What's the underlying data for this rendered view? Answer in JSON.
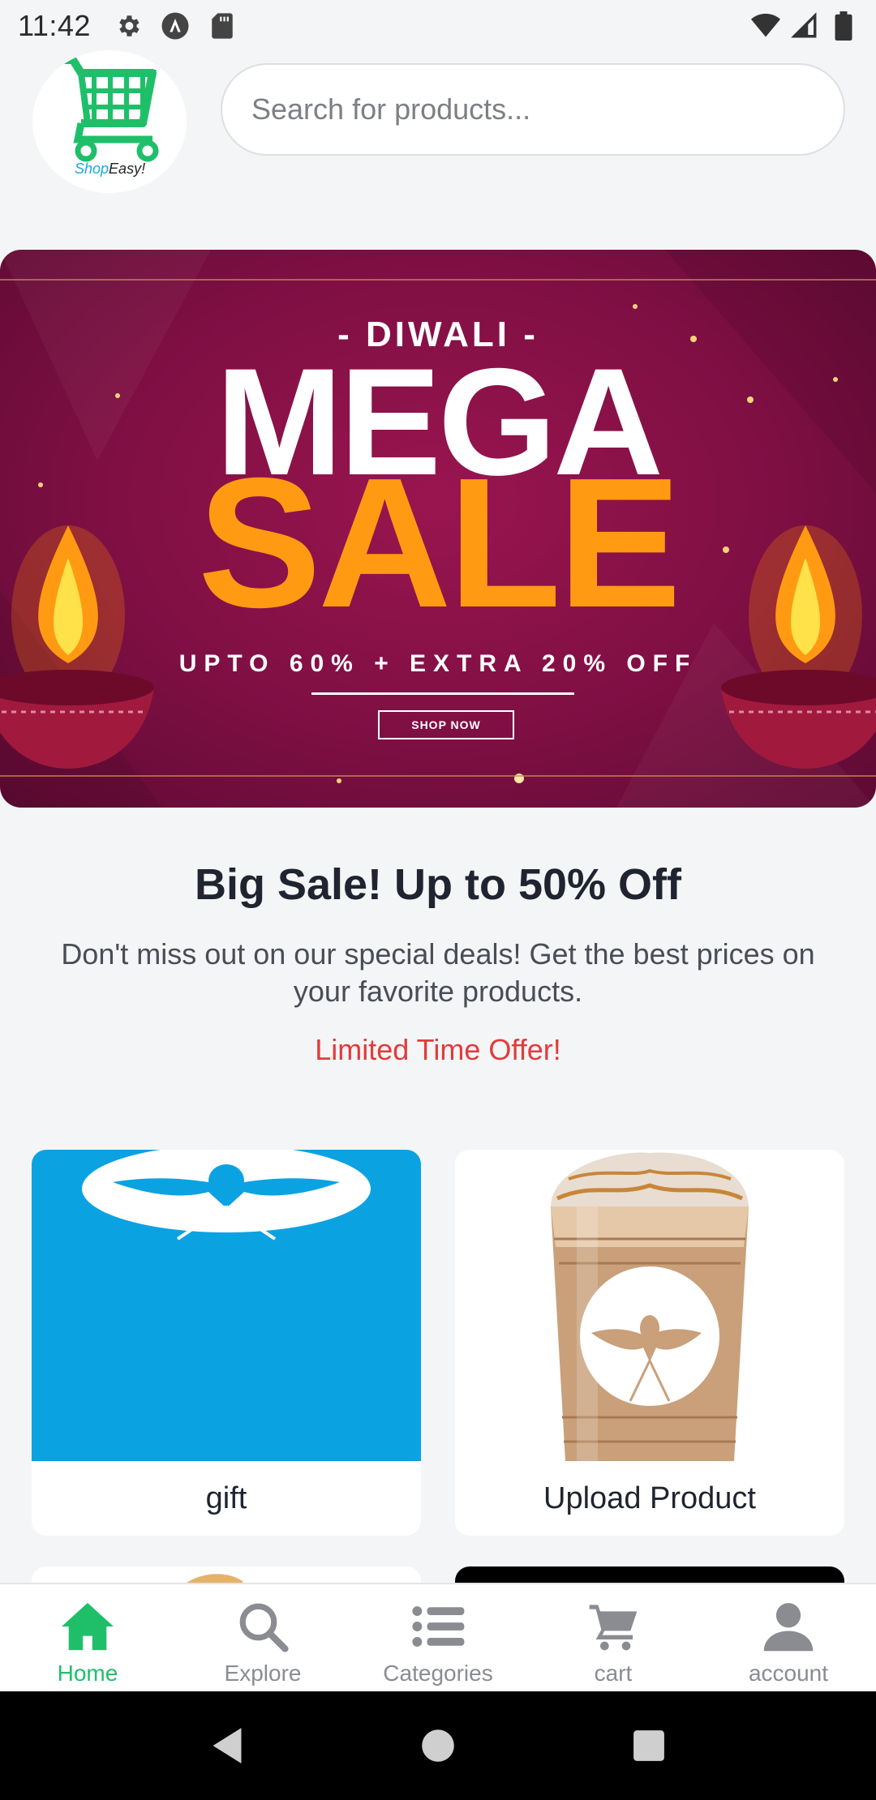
{
  "status_bar": {
    "time": "11:42",
    "left_icons": [
      "gear-icon",
      "a-circle-icon",
      "sd-card-icon"
    ],
    "right_icons": [
      "wifi-icon",
      "signal-icon",
      "battery-icon"
    ]
  },
  "header": {
    "logo": {
      "brand_part1": "Shop",
      "brand_part2": "Easy!"
    },
    "search": {
      "placeholder": "Search for products...",
      "value": ""
    }
  },
  "banner": {
    "kicker": "- DIWALI -",
    "headline_1": "MEGA",
    "headline_2": "SALE",
    "offer": "UPTO 60% + EXTRA 20% OFF",
    "cta": "SHOP NOW"
  },
  "promo": {
    "title": "Big Sale! Up to 50% Off",
    "description": "Don't miss out on our special deals! Get the best prices on your favorite products.",
    "limited": "Limited Time Offer!"
  },
  "products": [
    {
      "label": "gift"
    },
    {
      "label": "Upload Product"
    }
  ],
  "bottom_nav": {
    "items": [
      {
        "label": "Home",
        "icon": "home-icon",
        "active": true
      },
      {
        "label": "Explore",
        "icon": "search-icon",
        "active": false
      },
      {
        "label": "Categories",
        "icon": "list-icon",
        "active": false
      },
      {
        "label": "cart",
        "icon": "cart-icon",
        "active": false
      },
      {
        "label": "account",
        "icon": "person-icon",
        "active": false
      }
    ]
  },
  "colors": {
    "accent_green": "#1fbf6a",
    "offer_red": "#e23b3b",
    "banner_maroon": "#7e0f43",
    "sale_orange": "#ff9a12",
    "gift_blue": "#0ba2e2"
  }
}
